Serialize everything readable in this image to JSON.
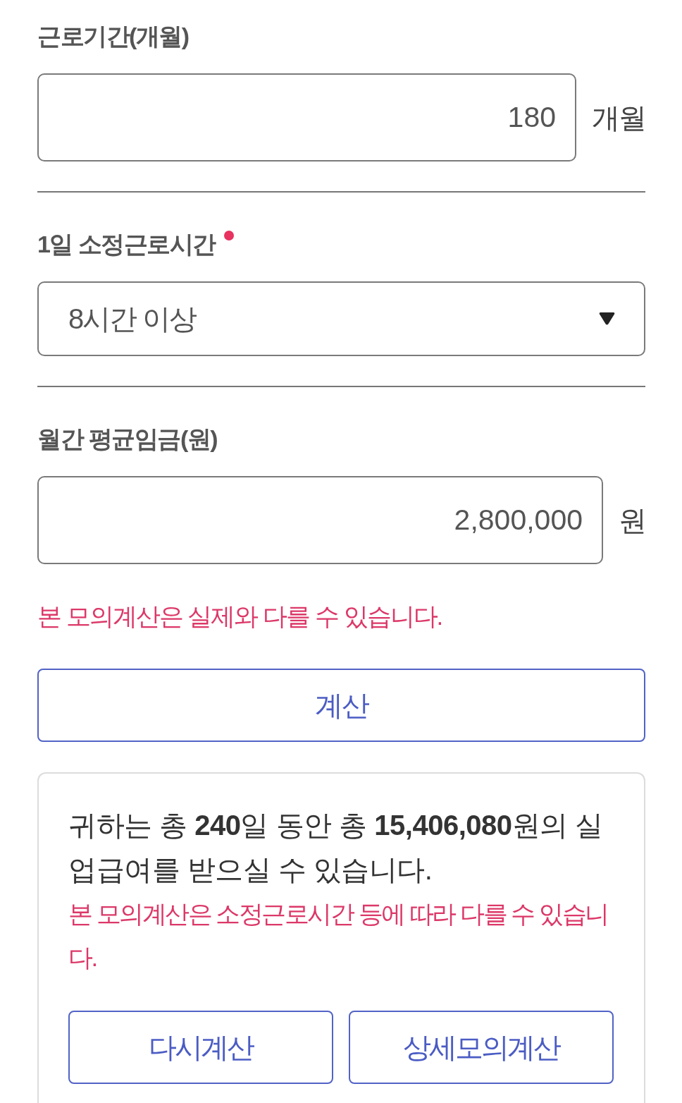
{
  "fields": [
    {
      "kind": "input",
      "label": "근로기간(개월)",
      "required": false,
      "value": "180",
      "unit": "개월"
    },
    {
      "kind": "select",
      "label": "1일 소정근로시간",
      "required": true,
      "value": "8시간 이상"
    },
    {
      "kind": "input",
      "label": "월간 평균임금(원)",
      "required": false,
      "value": "2,800,000",
      "unit": "원"
    }
  ],
  "notice": "본 모의계산은 실제와 다를 수 있습니다.",
  "calculate_button": "계산",
  "result": {
    "summary": "귀하는 총 **240**일 동안 총 **15,406,080**원의 실업급여를 받으실 수 있습니다.",
    "note": "본 모의계산은 소정근로시간 등에 따라 다를 수 있습니다.",
    "buttons": [
      "다시계산",
      "상세모의계산"
    ]
  }
}
